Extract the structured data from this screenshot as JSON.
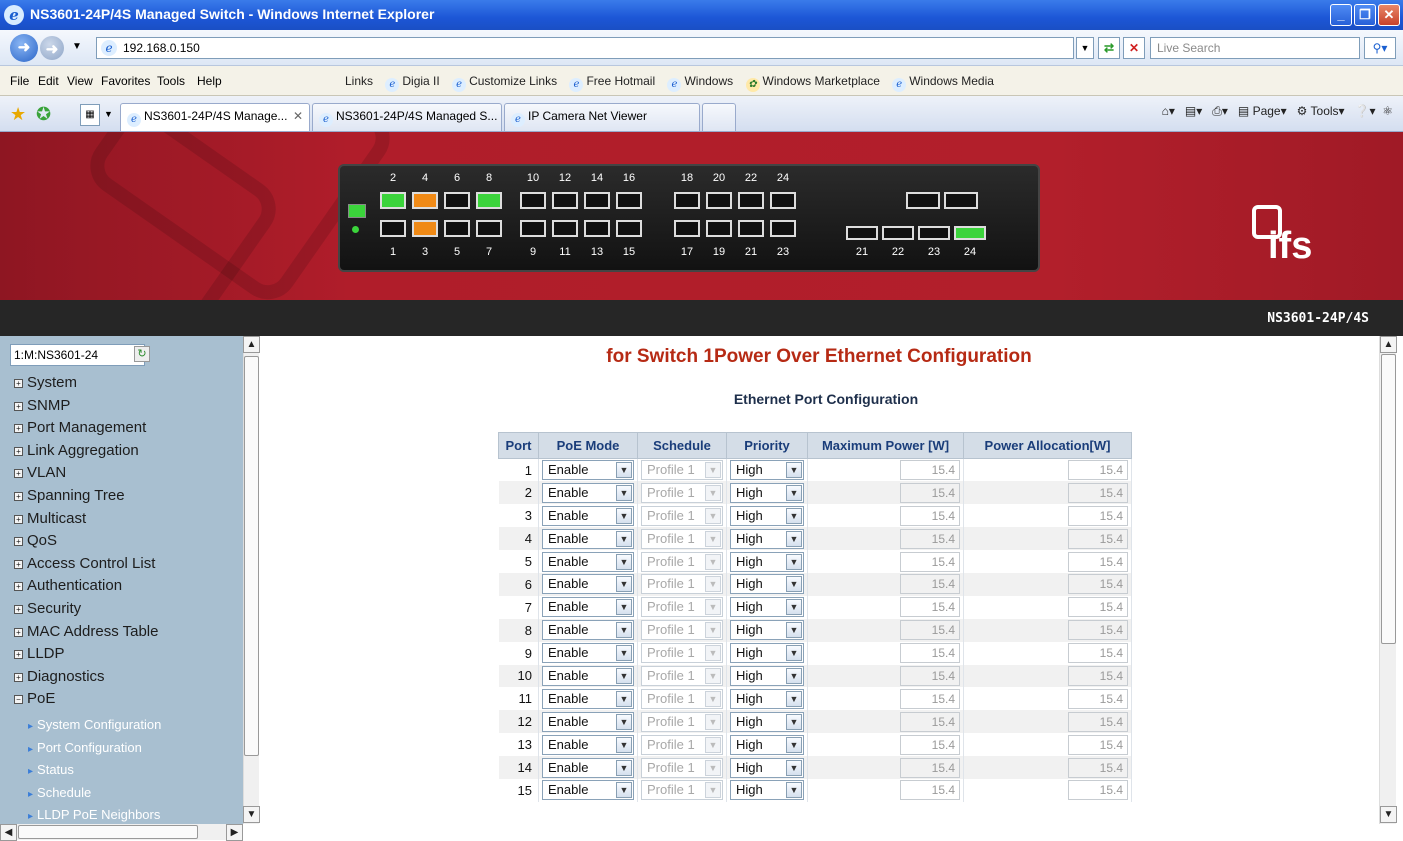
{
  "window": {
    "title": "NS3601-24P/4S Managed Switch - Windows Internet Explorer"
  },
  "address": {
    "url": "192.168.0.150",
    "search_placeholder": "Live Search"
  },
  "menu": {
    "file": "File",
    "edit": "Edit",
    "view": "View",
    "favorites": "Favorites",
    "tools": "Tools",
    "help": "Help"
  },
  "links_bar": {
    "label": "Links",
    "items": [
      "Digia II",
      "Customize Links",
      "Free Hotmail",
      "Windows",
      "Windows Marketplace",
      "Windows Media"
    ]
  },
  "tabs": [
    {
      "label": "NS3601-24P/4S Manage..."
    },
    {
      "label": "NS3601-24P/4S Managed S..."
    },
    {
      "label": "IP Camera Net Viewer"
    }
  ],
  "command_bar": {
    "page": "Page",
    "tools": "Tools"
  },
  "device": {
    "top_ports": [
      "2",
      "4",
      "6",
      "8",
      "10",
      "12",
      "14",
      "16",
      "18",
      "20",
      "22",
      "24"
    ],
    "bottom_ports": [
      "1",
      "3",
      "5",
      "7",
      "9",
      "11",
      "13",
      "15",
      "17",
      "19",
      "21",
      "23"
    ],
    "sfp_ports": [
      "21",
      "22",
      "23",
      "24"
    ],
    "brand": "ifs",
    "model": "NS3601-24P/4S"
  },
  "sidebar": {
    "switch_select": "1:M:NS3601-24",
    "items": [
      "System",
      "SNMP",
      "Port Management",
      "Link Aggregation",
      "VLAN",
      "Spanning Tree",
      "Multicast",
      "QoS",
      "Access Control List",
      "Authentication",
      "Security",
      "MAC Address Table",
      "LLDP",
      "Diagnostics",
      "PoE"
    ],
    "poe_sub": [
      "System Configuration",
      "Port Configuration",
      "Status",
      "Schedule",
      "LLDP PoE Neighbors"
    ]
  },
  "main": {
    "title": "for Switch 1Power Over Ethernet Configuration",
    "subtitle": "Ethernet Port Configuration",
    "columns": [
      "Port",
      "PoE Mode",
      "Schedule",
      "Priority",
      "Maximum Power [W]",
      "Power Allocation[W]"
    ],
    "rows": [
      {
        "port": "1",
        "mode": "Enable",
        "schedule": "Profile 1",
        "priority": "High",
        "max": "15.4",
        "alloc": "15.4"
      },
      {
        "port": "2",
        "mode": "Enable",
        "schedule": "Profile 1",
        "priority": "High",
        "max": "15.4",
        "alloc": "15.4"
      },
      {
        "port": "3",
        "mode": "Enable",
        "schedule": "Profile 1",
        "priority": "High",
        "max": "15.4",
        "alloc": "15.4"
      },
      {
        "port": "4",
        "mode": "Enable",
        "schedule": "Profile 1",
        "priority": "High",
        "max": "15.4",
        "alloc": "15.4"
      },
      {
        "port": "5",
        "mode": "Enable",
        "schedule": "Profile 1",
        "priority": "High",
        "max": "15.4",
        "alloc": "15.4"
      },
      {
        "port": "6",
        "mode": "Enable",
        "schedule": "Profile 1",
        "priority": "High",
        "max": "15.4",
        "alloc": "15.4"
      },
      {
        "port": "7",
        "mode": "Enable",
        "schedule": "Profile 1",
        "priority": "High",
        "max": "15.4",
        "alloc": "15.4"
      },
      {
        "port": "8",
        "mode": "Enable",
        "schedule": "Profile 1",
        "priority": "High",
        "max": "15.4",
        "alloc": "15.4"
      },
      {
        "port": "9",
        "mode": "Enable",
        "schedule": "Profile 1",
        "priority": "High",
        "max": "15.4",
        "alloc": "15.4"
      },
      {
        "port": "10",
        "mode": "Enable",
        "schedule": "Profile 1",
        "priority": "High",
        "max": "15.4",
        "alloc": "15.4"
      },
      {
        "port": "11",
        "mode": "Enable",
        "schedule": "Profile 1",
        "priority": "High",
        "max": "15.4",
        "alloc": "15.4"
      },
      {
        "port": "12",
        "mode": "Enable",
        "schedule": "Profile 1",
        "priority": "High",
        "max": "15.4",
        "alloc": "15.4"
      },
      {
        "port": "13",
        "mode": "Enable",
        "schedule": "Profile 1",
        "priority": "High",
        "max": "15.4",
        "alloc": "15.4"
      },
      {
        "port": "14",
        "mode": "Enable",
        "schedule": "Profile 1",
        "priority": "High",
        "max": "15.4",
        "alloc": "15.4"
      },
      {
        "port": "15",
        "mode": "Enable",
        "schedule": "Profile 1",
        "priority": "High",
        "max": "15.4",
        "alloc": "15.4"
      }
    ]
  }
}
